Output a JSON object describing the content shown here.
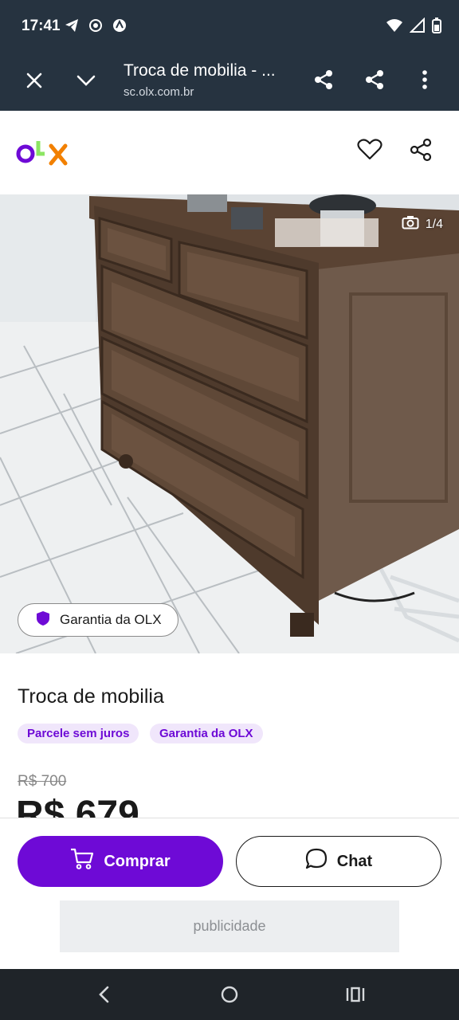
{
  "status": {
    "time": "17:41",
    "icons": [
      "telegram-icon",
      "cast-icon",
      "vpn-icon"
    ],
    "right_icons": [
      "wifi-icon",
      "signal-icon",
      "battery-icon"
    ]
  },
  "browser": {
    "title": "Troca de mobilia - ...",
    "url": "sc.olx.com.br"
  },
  "site": {
    "logo": "OLX"
  },
  "gallery": {
    "counter": "1/4",
    "guarantee": "Garantia da OLX"
  },
  "listing": {
    "title": "Troca de mobilia",
    "tags": [
      "Parcele sem juros",
      "Garantia da OLX"
    ],
    "old_price": "R$ 700",
    "price": "R$ 679"
  },
  "actions": {
    "buy_label": "Comprar",
    "chat_label": "Chat",
    "ad_label": "publicidade"
  },
  "colors": {
    "brand_purple": "#6e0ad6",
    "brand_orange": "#f28000",
    "brand_green": "#8ce563",
    "chrome_bg": "#263340"
  }
}
